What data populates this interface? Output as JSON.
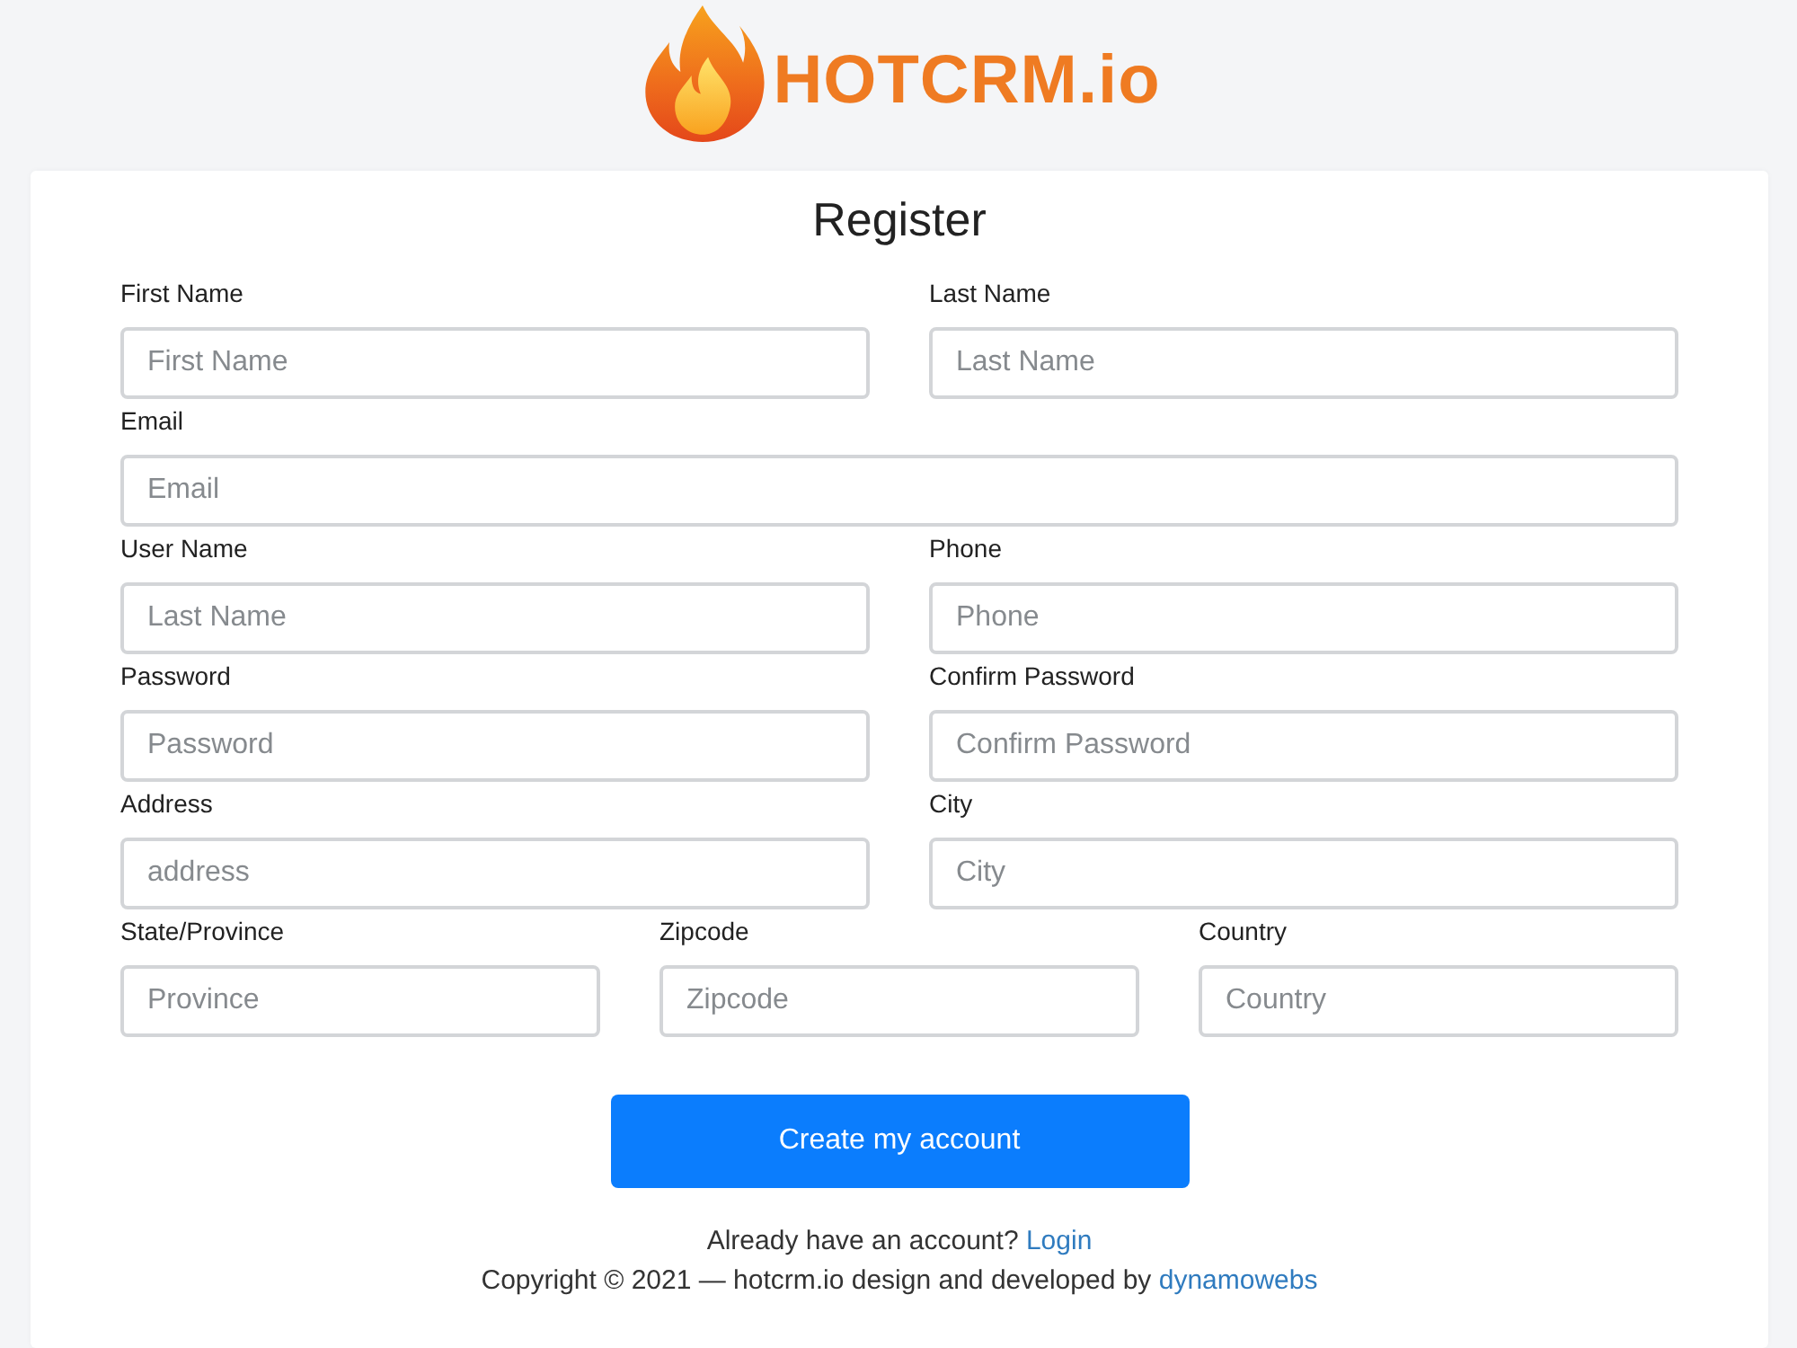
{
  "logo": {
    "text": "HOTCRM.io"
  },
  "form": {
    "title": "Register",
    "rows": [
      [
        {
          "label": "First Name",
          "placeholder": "First Name"
        },
        {
          "label": "Last Name",
          "placeholder": "Last Name"
        }
      ],
      [
        {
          "label": "Email",
          "placeholder": "Email"
        }
      ],
      [
        {
          "label": "User Name",
          "placeholder": "Last Name"
        },
        {
          "label": "Phone",
          "placeholder": "Phone"
        }
      ],
      [
        {
          "label": "Password",
          "placeholder": "Password"
        },
        {
          "label": "Confirm Password",
          "placeholder": "Confirm Password"
        }
      ],
      [
        {
          "label": "Address",
          "placeholder": "address"
        },
        {
          "label": "City",
          "placeholder": "City"
        }
      ],
      [
        {
          "label": "State/Province",
          "placeholder": "Province"
        },
        {
          "label": "Zipcode",
          "placeholder": "Zipcode"
        },
        {
          "label": "Country",
          "placeholder": "Country"
        }
      ]
    ],
    "submit": "Create my account"
  },
  "footer": {
    "login_prompt": "Already have an account?",
    "login_link": "Login",
    "copyright": "Copyright © 2021 — hotcrm.io design and developed by",
    "credit_link": "dynamowebs"
  }
}
